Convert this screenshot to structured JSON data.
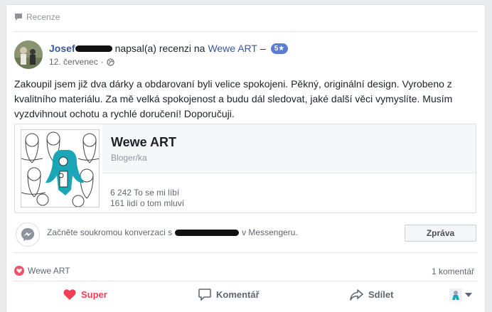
{
  "section": {
    "label": "Recenze"
  },
  "post": {
    "author_name": "Josef",
    "action_text": "napsal(a) recenzi na",
    "page_link": "Wewe ART",
    "dash": "–",
    "rating": "5★",
    "date": "12. červenec",
    "privacy_icon": "globe-icon",
    "text": "Zakoupil jsem již dva dárky a obdarovaní byli velice spokojeni. Pěkný, originální design. Vyrobeno z kvalitního materiálu. Za mě velká spokojenost a budu dál sledovat, jaké další věci vymyslíte. Musím vyzdvihnout ochotu a rychlé doručení! Doporučuji."
  },
  "page_card": {
    "title": "Wewe ART",
    "subtitle": "Bloger/ka",
    "likes": "6 242 To se mi líbí",
    "talking": "161 lidí o tom mluví"
  },
  "messenger": {
    "prefix": "Začněte soukromou konverzaci s",
    "suffix": "v Messengeru.",
    "button": "Zpráva"
  },
  "footer": {
    "reaction_name": "Wewe ART",
    "comment_count": "1 komentář",
    "like_label": "Super",
    "comment_label": "Komentář",
    "share_label": "Sdílet"
  },
  "colors": {
    "link": "#385898",
    "love": "#f33e58",
    "badge": "#5b7bd5"
  }
}
